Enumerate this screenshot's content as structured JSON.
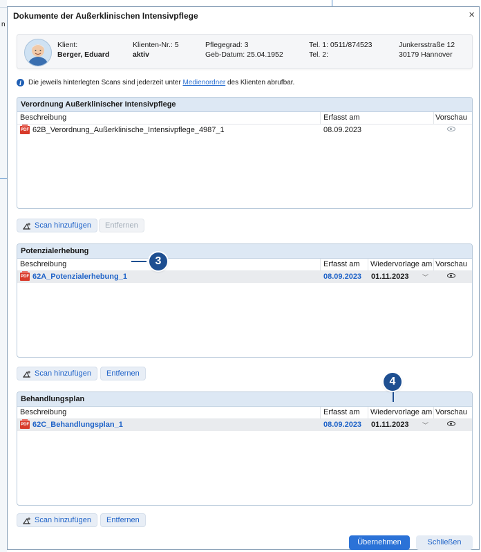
{
  "background": {
    "left_text": "n"
  },
  "dialog": {
    "title": "Dokumente der Außerklinischen Intensivpflege",
    "close_glyph": "×"
  },
  "client": {
    "label": "Klient:",
    "name": "Berger, Eduard",
    "number": "Klienten-Nr.: 5",
    "status": "aktiv",
    "care_level": "Pflegegrad: 3",
    "birth": "Geb-Datum: 25.04.1952",
    "tel1": "Tel. 1: 0511/874523",
    "tel2": "Tel. 2:",
    "street": "Junkersstraße 12",
    "city": "30179 Hannover"
  },
  "info": {
    "icon": "i",
    "before": "Die jeweils hinterlegten Scans sind jederzeit unter",
    "link": "Medienordner",
    "after": "des Klienten abrufbar."
  },
  "columns": {
    "desc": "Beschreibung",
    "date": "Erfasst am",
    "followup": "Wiedervorlage am",
    "preview": "Vorschau"
  },
  "panels": [
    {
      "title": "Verordnung Außerklinischer Intensivpflege",
      "rows": [
        {
          "name": "62B_Verordnung_Außerklinische_Intensivpflege_4987_1",
          "date": "08.09.2023"
        }
      ]
    },
    {
      "title": "Potenzialerhebung",
      "rows": [
        {
          "name": "62A_Potenzialerhebung_1",
          "date": "08.09.2023",
          "followup": "01.11.2023"
        }
      ]
    },
    {
      "title": "Behandlungsplan",
      "rows": [
        {
          "name": "62C_Behandlungsplan_1",
          "date": "08.09.2023",
          "followup": "01.11.2023"
        }
      ]
    }
  ],
  "pdf_label": "PDF",
  "buttons": {
    "add_scan": "Scan hinzufügen",
    "remove": "Entfernen",
    "apply": "Übernehmen",
    "close": "Schließen"
  },
  "markers": {
    "m3": "3",
    "m4": "4"
  },
  "colors": {
    "accent": "#2b72d7",
    "marker": "#1e4f91",
    "panel_header": "#dde8f4",
    "pdf": "#d83b2b"
  }
}
